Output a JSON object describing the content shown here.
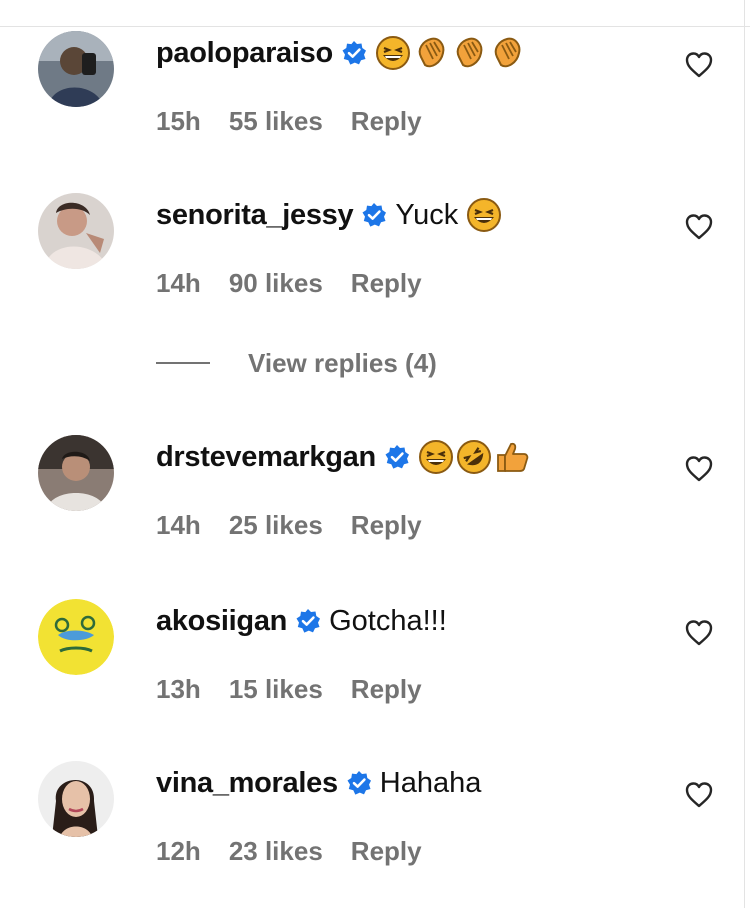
{
  "comments": [
    {
      "username": "paoloparaiso",
      "text": "",
      "emojis": [
        "grinning-squint-face",
        "clapping-hands",
        "clapping-hands",
        "clapping-hands"
      ],
      "time": "15h",
      "likes": "55 likes",
      "reply": "Reply",
      "avatar": "person-photo-dark"
    },
    {
      "username": "senorita_jessy",
      "text": "Yuck",
      "emojis": [
        "grinning-squint-face"
      ],
      "time": "14h",
      "likes": "90 likes",
      "reply": "Reply",
      "avatar": "person-photo-light"
    },
    {
      "username": "drstevemarkgan",
      "text": "",
      "emojis": [
        "grinning-squint-face",
        "rolling-on-floor-laughing",
        "thumbs-up"
      ],
      "time": "14h",
      "likes": "25 likes",
      "reply": "Reply",
      "avatar": "person-photo-dark"
    },
    {
      "username": "akosiigan",
      "text": "Gotcha!!!",
      "emojis": [],
      "time": "13h",
      "likes": "15 likes",
      "reply": "Reply",
      "avatar": "yellow-logo"
    },
    {
      "username": "vina_morales",
      "text": "Hahaha",
      "emojis": [],
      "time": "12h",
      "likes": "23 likes",
      "reply": "Reply",
      "avatar": "woman-photo"
    }
  ],
  "view_replies": "View replies (4)",
  "colors": {
    "verified": "#1d76e8",
    "emoji_face": "#f4b52a",
    "emoji_outline": "#8a5a12",
    "meta": "#737373"
  }
}
